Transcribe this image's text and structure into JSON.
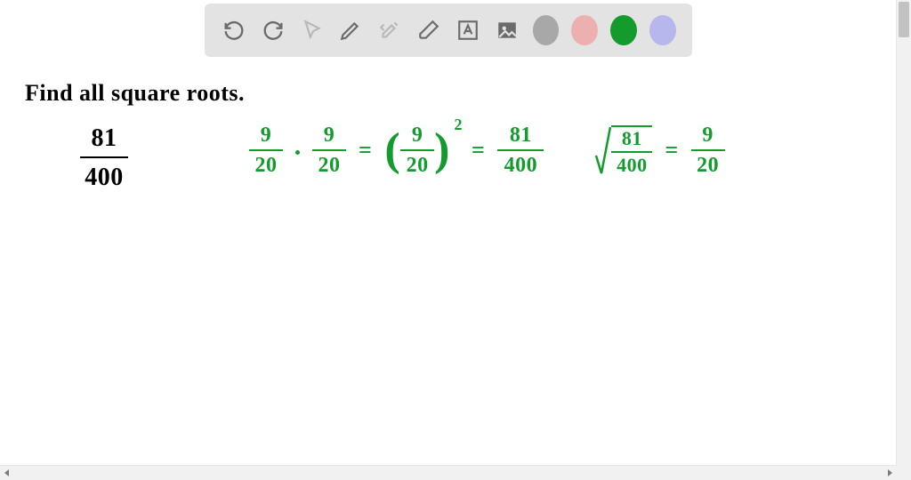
{
  "toolbar": {
    "undo": "undo-icon",
    "redo": "redo-icon",
    "pointer": "pointer-icon",
    "pen": "pen-icon",
    "tools": "tools-icon",
    "eraser": "eraser-icon",
    "text": "text-icon",
    "image": "image-icon",
    "colors": [
      "gray",
      "pink",
      "green",
      "purple"
    ]
  },
  "title": "Find all square roots.",
  "problem": {
    "numer": "81",
    "denom": "400"
  },
  "work": {
    "f1n": "9",
    "f1d": "20",
    "f2n": "9",
    "f2d": "20",
    "sqlabel": "2",
    "sqn": "9",
    "sqd": "20",
    "resn": "81",
    "resd": "400",
    "radn": "81",
    "radd": "400",
    "ansn": "9",
    "ansd": "20",
    "eq": "="
  }
}
